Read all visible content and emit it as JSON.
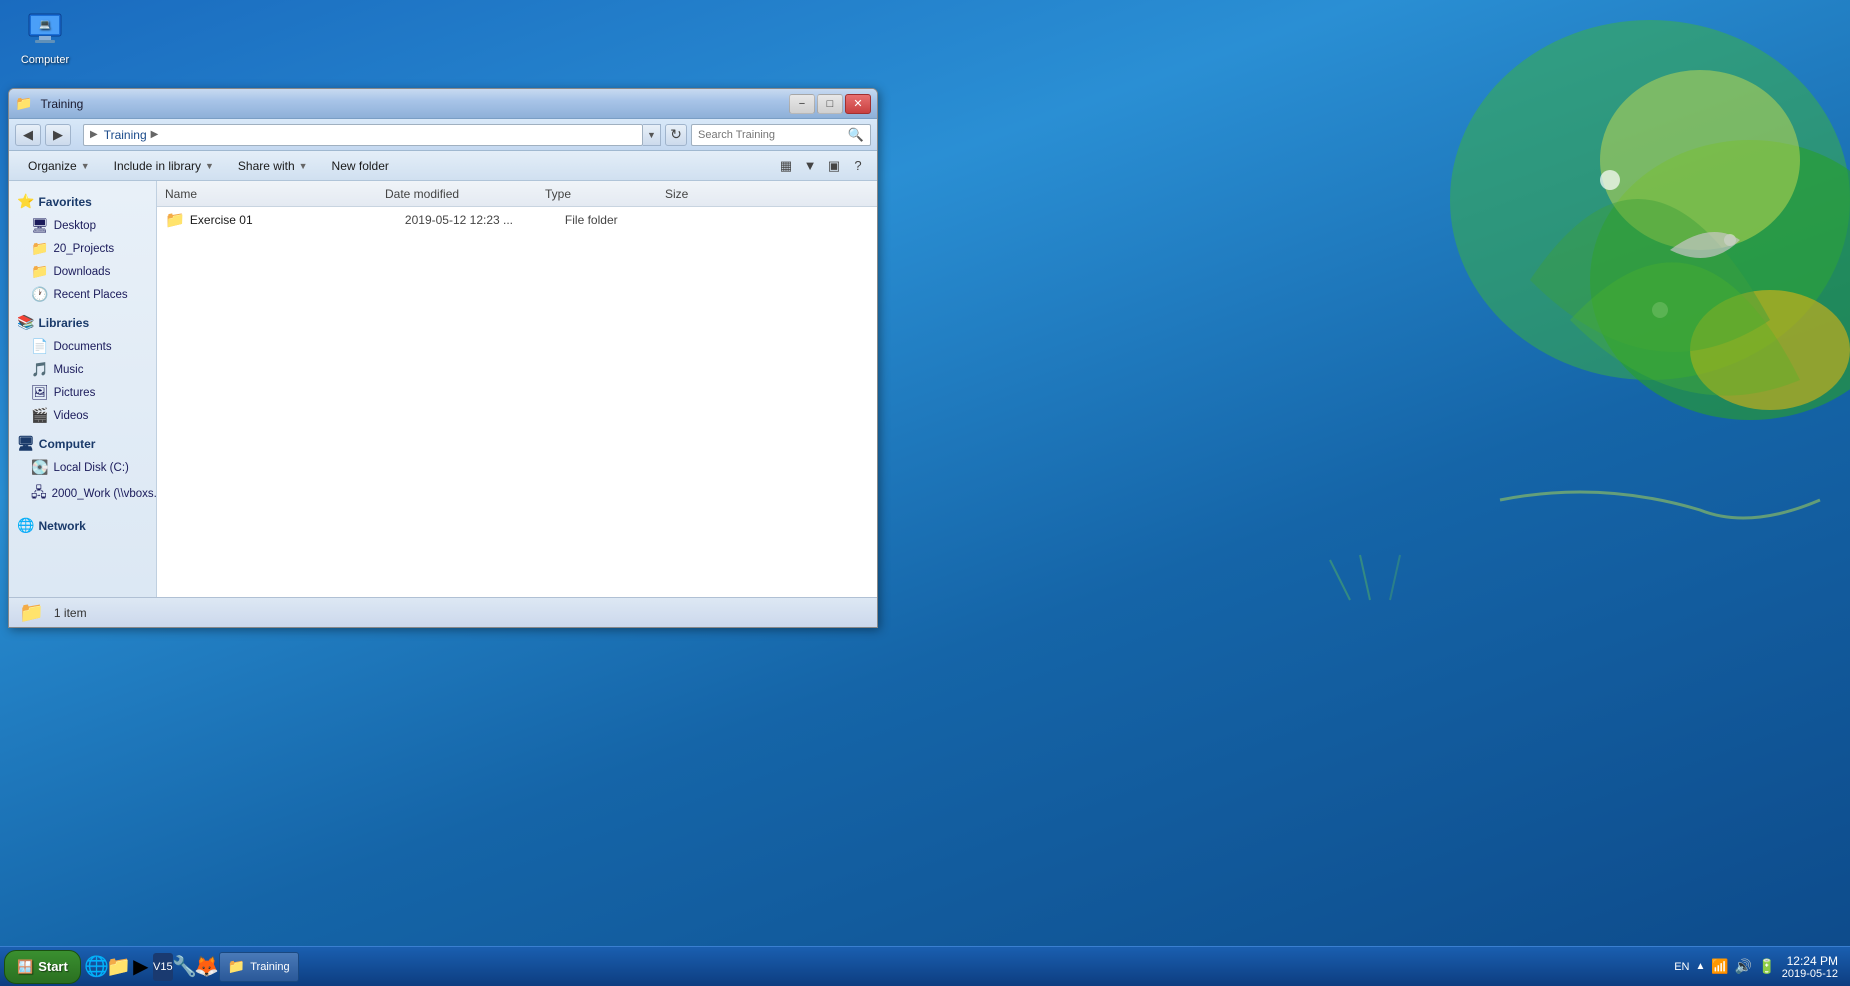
{
  "desktop": {
    "icon_label": "Computer"
  },
  "window": {
    "title": "Training",
    "minimize_label": "−",
    "maximize_label": "□",
    "close_label": "✕"
  },
  "addressbar": {
    "back_label": "◀",
    "forward_label": "▶",
    "breadcrumb": [
      "▶",
      "Training",
      "▶"
    ],
    "breadcrumb_root": "",
    "path_label": "Training",
    "refresh_label": "↻",
    "search_placeholder": "Search Training"
  },
  "toolbar": {
    "organize_label": "Organize",
    "include_label": "Include in library",
    "share_label": "Share with",
    "new_folder_label": "New folder",
    "help_label": "?"
  },
  "sidebar": {
    "favorites_label": "Favorites",
    "items_favorites": [
      {
        "label": "Desktop",
        "icon": "🖥"
      },
      {
        "label": "20_Projects",
        "icon": "📁"
      },
      {
        "label": "Downloads",
        "icon": "📁"
      },
      {
        "label": "Recent Places",
        "icon": "🕐"
      }
    ],
    "libraries_label": "Libraries",
    "items_libraries": [
      {
        "label": "Documents",
        "icon": "📄"
      },
      {
        "label": "Music",
        "icon": "🎵"
      },
      {
        "label": "Pictures",
        "icon": "🖼"
      },
      {
        "label": "Videos",
        "icon": "🎬"
      }
    ],
    "computer_label": "Computer",
    "items_computer": [
      {
        "label": "Local Disk (C:)",
        "icon": "💽"
      },
      {
        "label": "2000_Work (\\\\vboxs...",
        "icon": "🖧"
      }
    ],
    "network_label": "Network"
  },
  "file_list": {
    "col_name": "Name",
    "col_date": "Date modified",
    "col_type": "Type",
    "col_size": "Size",
    "items": [
      {
        "name": "Exercise 01",
        "date": "2019-05-12 12:23 ...",
        "type": "File folder",
        "size": "",
        "icon": "📁"
      }
    ]
  },
  "statusbar": {
    "text": "1 item",
    "icon": "📁"
  },
  "taskbar": {
    "start_label": "Start",
    "items": [
      {
        "label": "Training",
        "icon": "📁"
      }
    ],
    "tray_lang": "EN",
    "clock_time": "12:24 PM",
    "clock_date": "2019-05-12"
  }
}
